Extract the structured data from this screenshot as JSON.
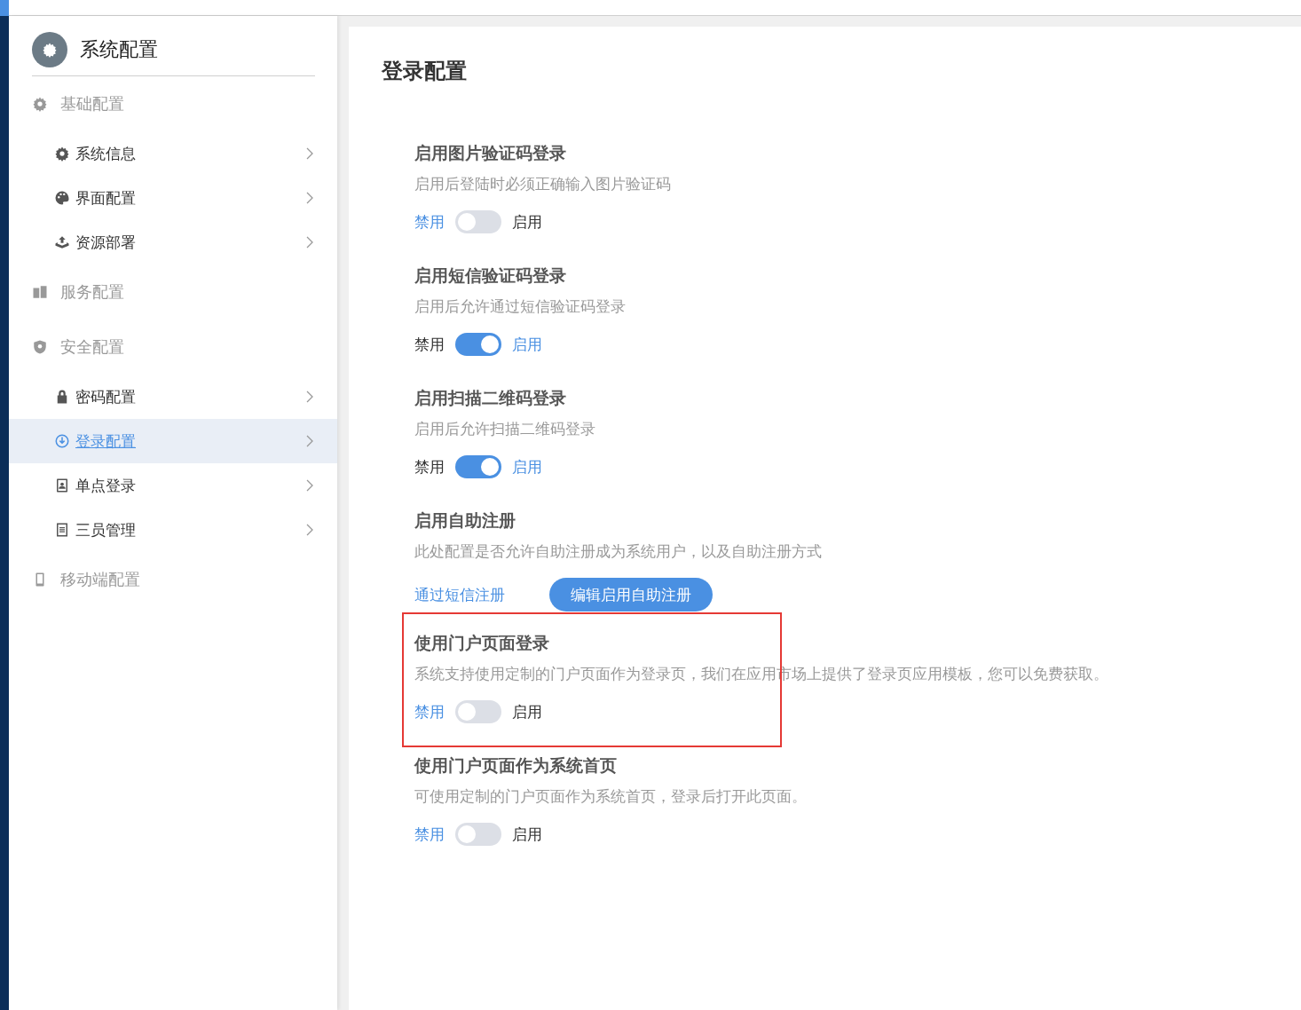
{
  "sidebar": {
    "title": "系统配置",
    "groups": [
      {
        "label": "基础配置",
        "children": [
          {
            "label": "系统信息",
            "selected": false
          },
          {
            "label": "界面配置",
            "selected": false
          },
          {
            "label": "资源部署",
            "selected": false
          }
        ]
      },
      {
        "label": "服务配置"
      },
      {
        "label": "安全配置",
        "children": [
          {
            "label": "密码配置",
            "selected": false
          },
          {
            "label": "登录配置",
            "selected": true
          },
          {
            "label": "单点登录",
            "selected": false
          },
          {
            "label": "三员管理",
            "selected": false
          }
        ]
      },
      {
        "label": "移动端配置"
      }
    ]
  },
  "page": {
    "title": "登录配置",
    "sections": [
      {
        "kind": "toggle",
        "title": "启用图片验证码登录",
        "description": "启用后登陆时必须正确输入图片验证码",
        "off_label": "禁用",
        "on_label": "启用",
        "on": false,
        "highlighted": false
      },
      {
        "kind": "toggle",
        "title": "启用短信验证码登录",
        "description": "启用后允许通过短信验证码登录",
        "off_label": "禁用",
        "on_label": "启用",
        "on": true,
        "highlighted": false
      },
      {
        "kind": "toggle",
        "title": "启用扫描二维码登录",
        "description": "启用后允许扫描二维码登录",
        "off_label": "禁用",
        "on_label": "启用",
        "on": true,
        "highlighted": false
      },
      {
        "kind": "action",
        "title": "启用自助注册",
        "description": "此处配置是否允许自助注册成为系统用户，以及自助注册方式",
        "link": "通过短信注册",
        "button": "编辑启用自助注册",
        "highlighted": false
      },
      {
        "kind": "toggle",
        "title": "使用门户页面登录",
        "description": "系统支持使用定制的门户页面作为登录页，我们在应用市场上提供了登录页应用模板，您可以免费获取。",
        "off_label": "禁用",
        "on_label": "启用",
        "on": false,
        "highlighted": true
      },
      {
        "kind": "toggle",
        "title": "使用门户页面作为系统首页",
        "description": "可使用定制的门户页面作为系统首页，登录后打开此页面。",
        "off_label": "禁用",
        "on_label": "启用",
        "on": false,
        "highlighted": false
      }
    ]
  }
}
